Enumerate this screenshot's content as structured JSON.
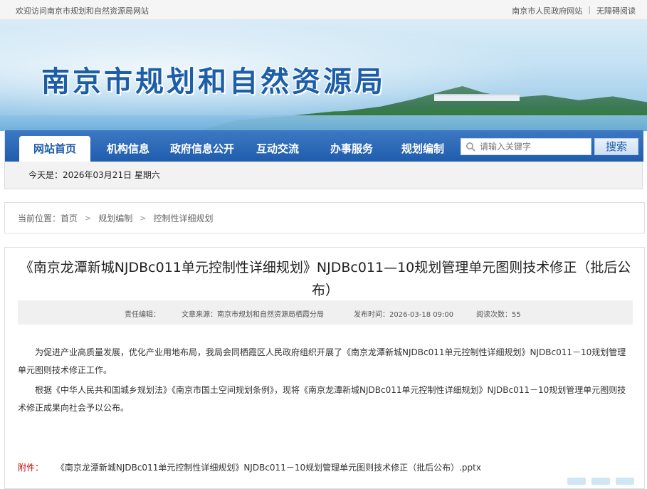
{
  "topbar": {
    "welcome": "欢迎访问南京市规划和自然资源局网站",
    "links": [
      "南京市人民政府网站",
      "无障碍阅读"
    ],
    "separator": "|"
  },
  "banner": {
    "title": "南京市规划和自然资源局"
  },
  "nav": {
    "items": [
      "网站首页",
      "机构信息",
      "政府信息公开",
      "互动交流",
      "办事服务",
      "规划编制"
    ],
    "active_index": 0,
    "search_placeholder": "请输入关键字",
    "search_button": "搜索",
    "today": "今天是：2026年03月21日 星期六"
  },
  "breadcrumb": {
    "label": "当前位置：",
    "items": [
      "首页",
      "规划编制",
      "控制性详细规划"
    ],
    "separator": ">"
  },
  "article": {
    "title": "《南京龙潭新城NJDBc011单元控制性详细规划》NJDBc011—10规划管理单元图则技术修正（批后公布）",
    "meta": {
      "editor": "责任编辑：",
      "source": "文章来源：南京市规划和自然资源局栖霞分局",
      "date": "发布时间：2026-03-18 09:00",
      "views": "阅读次数：55"
    },
    "paragraphs": [
      "为促进产业高质量发展，优化产业用地布局，我局会同栖霞区人民政府组织开展了《南京龙潭新城NJDBc011单元控制性详细规划》NJDBc011－10规划管理单元图则技术修正工作。",
      "根据《中华人民共和国城乡规划法》《南京市国土空间规划条例》，现将《南京龙潭新城NJDBc011单元控制性详细规划》NJDBc011－10规划管理单元图则技术修正成果向社会予以公布。"
    ],
    "attachment_label": "附件：",
    "attachment_name": "《南京龙潭新城NJDBc011单元控制性详细规划》NJDBc011－10规划管理单元图则技术修正（批后公布）.pptx"
  },
  "colors": {
    "nav_blue": "#1f5dad",
    "title_blue": "#1d5ea8",
    "attachment_red": "#c00000"
  }
}
